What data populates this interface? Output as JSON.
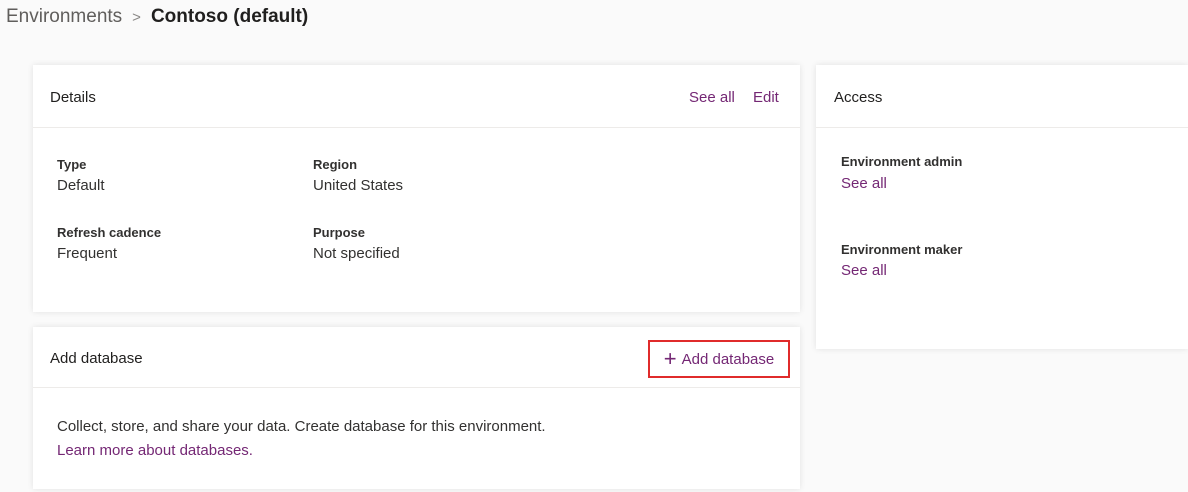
{
  "breadcrumb": {
    "parent": "Environments",
    "separator": ">",
    "current": "Contoso (default)"
  },
  "details": {
    "title": "Details",
    "see_all": "See all",
    "edit": "Edit",
    "fields": {
      "type_label": "Type",
      "type_value": "Default",
      "region_label": "Region",
      "region_value": "United States",
      "refresh_label": "Refresh cadence",
      "refresh_value": "Frequent",
      "purpose_label": "Purpose",
      "purpose_value": "Not specified"
    }
  },
  "access": {
    "title": "Access",
    "admin_label": "Environment admin",
    "admin_link": "See all",
    "maker_label": "Environment maker",
    "maker_link": "See all"
  },
  "add_database": {
    "title": "Add database",
    "button_icon": "+",
    "button_label": "Add database",
    "description": "Collect, store, and share your data. Create database for this environment.",
    "learn_more": "Learn more about databases."
  },
  "colors": {
    "link": "#742774",
    "highlight_border": "#e02b2b"
  }
}
